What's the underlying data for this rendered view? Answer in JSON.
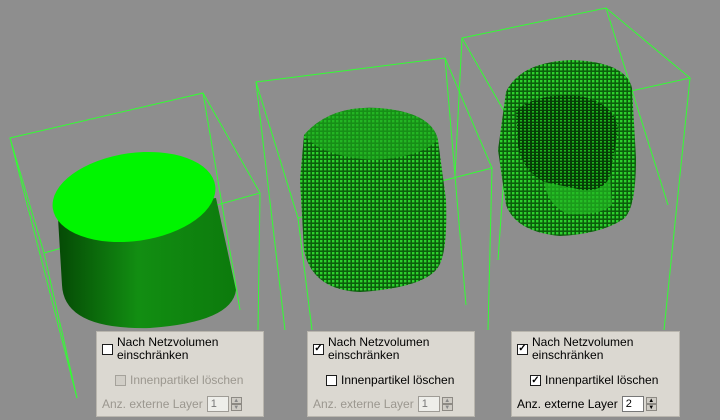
{
  "scene": {
    "background": "#8e8e8e",
    "wire_color": "#32ff32",
    "solid_fill": "#119a11",
    "top_face": "#00ff00",
    "particle_color": "#10a810"
  },
  "panels": [
    {
      "restrict_checked": false,
      "restrict_label": "Nach Netzvolumen einschränken",
      "delete_checked": false,
      "delete_label": "Innenpartikel löschen",
      "delete_disabled": true,
      "layers_label": "Anz. externe Layer",
      "layers_value": "1",
      "layers_disabled": true
    },
    {
      "restrict_checked": true,
      "restrict_label": "Nach Netzvolumen einschränken",
      "delete_checked": false,
      "delete_label": "Innenpartikel löschen",
      "delete_disabled": false,
      "layers_label": "Anz. externe Layer",
      "layers_value": "1",
      "layers_disabled": true
    },
    {
      "restrict_checked": true,
      "restrict_label": "Nach Netzvolumen einschränken",
      "delete_checked": true,
      "delete_label": "Innenpartikel löschen",
      "delete_disabled": false,
      "layers_label": "Anz. externe Layer",
      "layers_value": "2",
      "layers_disabled": false
    }
  ]
}
